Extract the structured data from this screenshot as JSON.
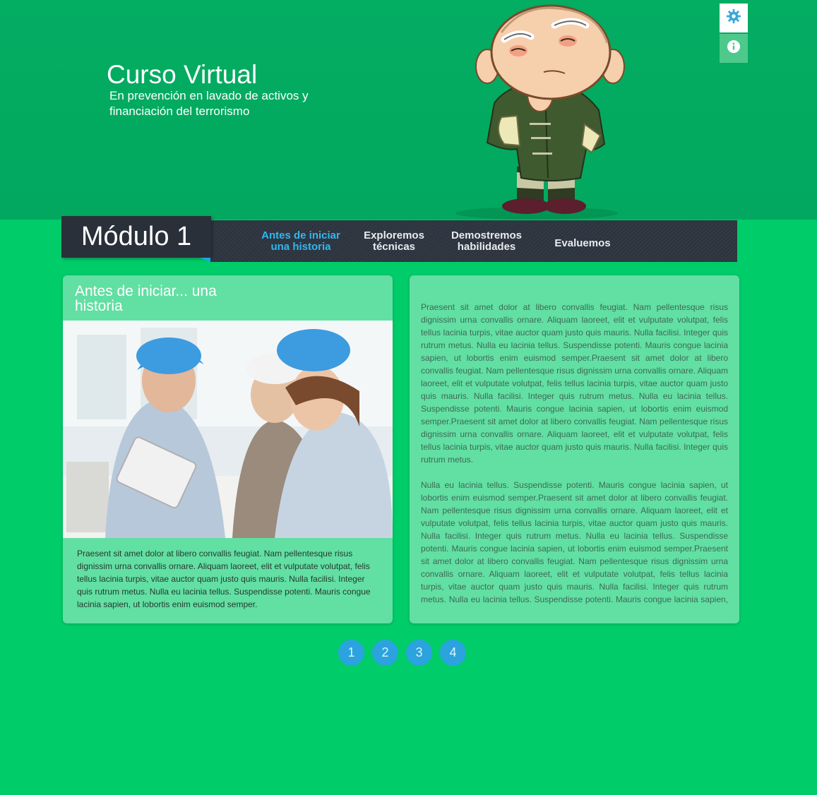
{
  "header": {
    "title": "Curso Virtual",
    "subtitle": "En prevención en lavado de activos y financiación del terrorismo",
    "colors": {
      "background": "#03ad62",
      "page": "#00cc6a"
    }
  },
  "tools": [
    {
      "icon": "gear-icon"
    },
    {
      "icon": "info-icon"
    }
  ],
  "module": {
    "label": "Módulo 1"
  },
  "nav": {
    "items": [
      {
        "label": "Antes de iniciar una historia",
        "active": true
      },
      {
        "label": "Exploremos técnicas"
      },
      {
        "label": "Demostremos habilidades"
      },
      {
        "label": "Evaluemos"
      }
    ],
    "colors": {
      "active": "#30b8f0",
      "text": "#e9ecef"
    }
  },
  "left_card": {
    "heading": "Antes de iniciar... una historia",
    "text": "Praesent sit amet dolor at libero convallis feugiat. Nam pellentesque risus dignissim urna convallis ornare. Aliquam laoreet, elit et vulputate volutpat, felis tellus lacinia turpis, vitae auctor quam justo quis mauris. Nulla facilisi. Integer quis rutrum metus. Nulla eu lacinia tellus. Suspendisse potenti. Mauris congue lacinia sapien, ut lobortis enim euismod semper."
  },
  "right_card": {
    "paragraphs": [
      "Praesent sit amet dolor at libero convallis feugiat. Nam pellentesque risus dignissim urna convallis ornare. Aliquam laoreet, elit et vulputate volutpat, felis tellus lacinia turpis, vitae auctor quam justo quis mauris. Nulla facilisi. Integer quis rutrum metus. Nulla eu lacinia tellus. Suspendisse potenti. Mauris congue lacinia sapien, ut lobortis enim euismod semper.Praesent sit amet dolor at libero convallis feugiat. Nam pellentesque risus dignissim urna convallis ornare. Aliquam laoreet, elit et vulputate volutpat, felis tellus lacinia turpis, vitae auctor quam justo quis mauris. Nulla facilisi. Integer quis rutrum metus. Nulla eu lacinia tellus. Suspendisse potenti. Mauris congue lacinia sapien, ut lobortis enim euismod semper.Praesent sit amet dolor at libero convallis feugiat. Nam pellentesque risus dignissim urna convallis ornare. Aliquam laoreet, elit et vulputate volutpat, felis tellus lacinia turpis, vitae auctor quam justo quis mauris. Nulla facilisi. Integer quis rutrum metus.",
      "Nulla eu lacinia tellus. Suspendisse potenti. Mauris congue lacinia sapien, ut lobortis enim euismod semper.Praesent sit amet dolor at libero convallis feugiat. Nam pellentesque risus dignissim urna convallis ornare. Aliquam laoreet, elit et vulputate volutpat, felis tellus lacinia turpis, vitae auctor quam justo quis mauris. Nulla facilisi. Integer quis rutrum metus. Nulla eu lacinia tellus. Suspendisse potenti. Mauris congue lacinia sapien, ut lobortis enim euismod semper.Praesent sit amet dolor at libero convallis feugiat. Nam pellentesque risus dignissim urna convallis ornare. Aliquam laoreet, elit et vulputate volutpat, felis tellus lacinia turpis, vitae auctor quam justo quis mauris. Nulla facilisi. Integer quis rutrum metus. Nulla eu lacinia tellus. Suspendisse potenti. Mauris congue lacinia sapien, ut lobortis"
    ]
  },
  "pagination": [
    "1",
    "2",
    "3",
    "4"
  ]
}
